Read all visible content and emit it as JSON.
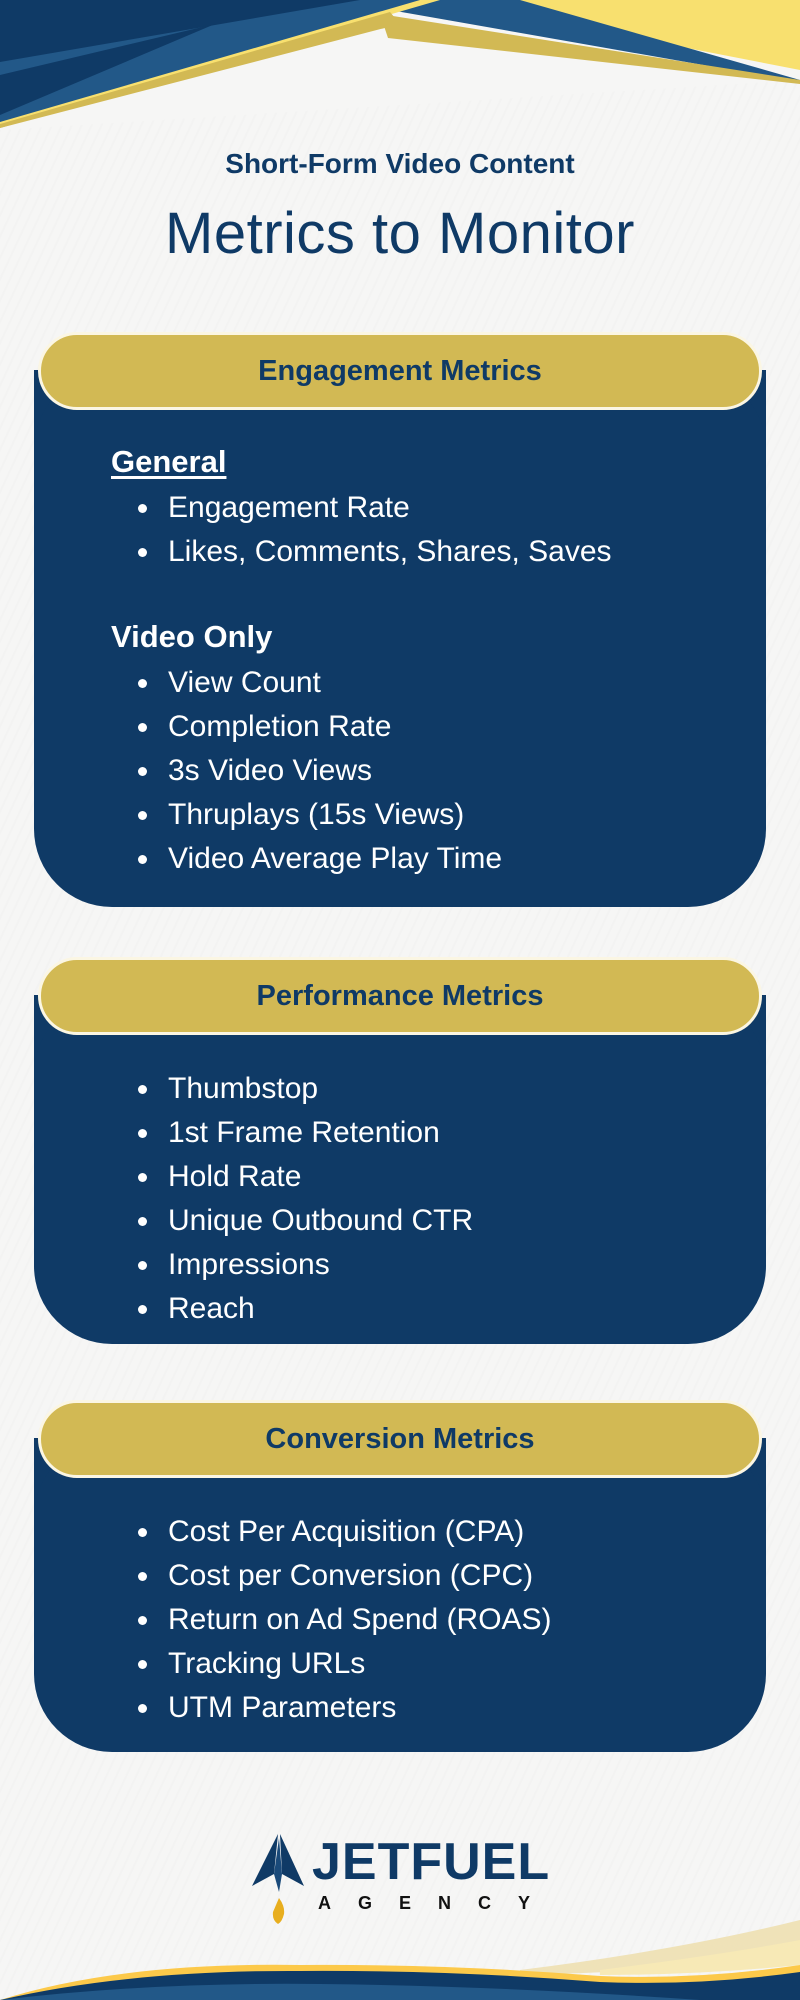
{
  "header": {
    "subtitle": "Short-Form Video Content",
    "title": "Metrics to Monitor"
  },
  "sections": [
    {
      "title": "Engagement Metrics",
      "groups": [
        {
          "heading": "General",
          "items": [
            "Engagement Rate",
            "Likes, Comments, Shares, Saves"
          ]
        },
        {
          "heading": "Video Only",
          "items": [
            "View Count",
            "Completion Rate",
            "3s Video Views",
            "Thruplays (15s Views)",
            "Video Average Play Time"
          ]
        }
      ]
    },
    {
      "title": "Performance Metrics",
      "items": [
        "Thumbstop",
        "1st Frame Retention",
        "Hold Rate",
        "Unique Outbound CTR",
        "Impressions",
        "Reach"
      ]
    },
    {
      "title": "Conversion Metrics",
      "items": [
        "Cost Per Acquisition (CPA)",
        "Cost per Conversion (CPC)",
        "Return on Ad Spend (ROAS)",
        "Tracking URLs",
        "UTM Parameters"
      ]
    }
  ],
  "logo": {
    "name": "JETFUEL",
    "tagline": "AGENCY",
    "icon": "paper-plane-rocket-icon"
  },
  "colors": {
    "navy": "#0f3a66",
    "mid_blue": "#225888",
    "gold": "#d2b954",
    "light_yellow": "#f8e06f",
    "flame": "#e8ae1e"
  }
}
